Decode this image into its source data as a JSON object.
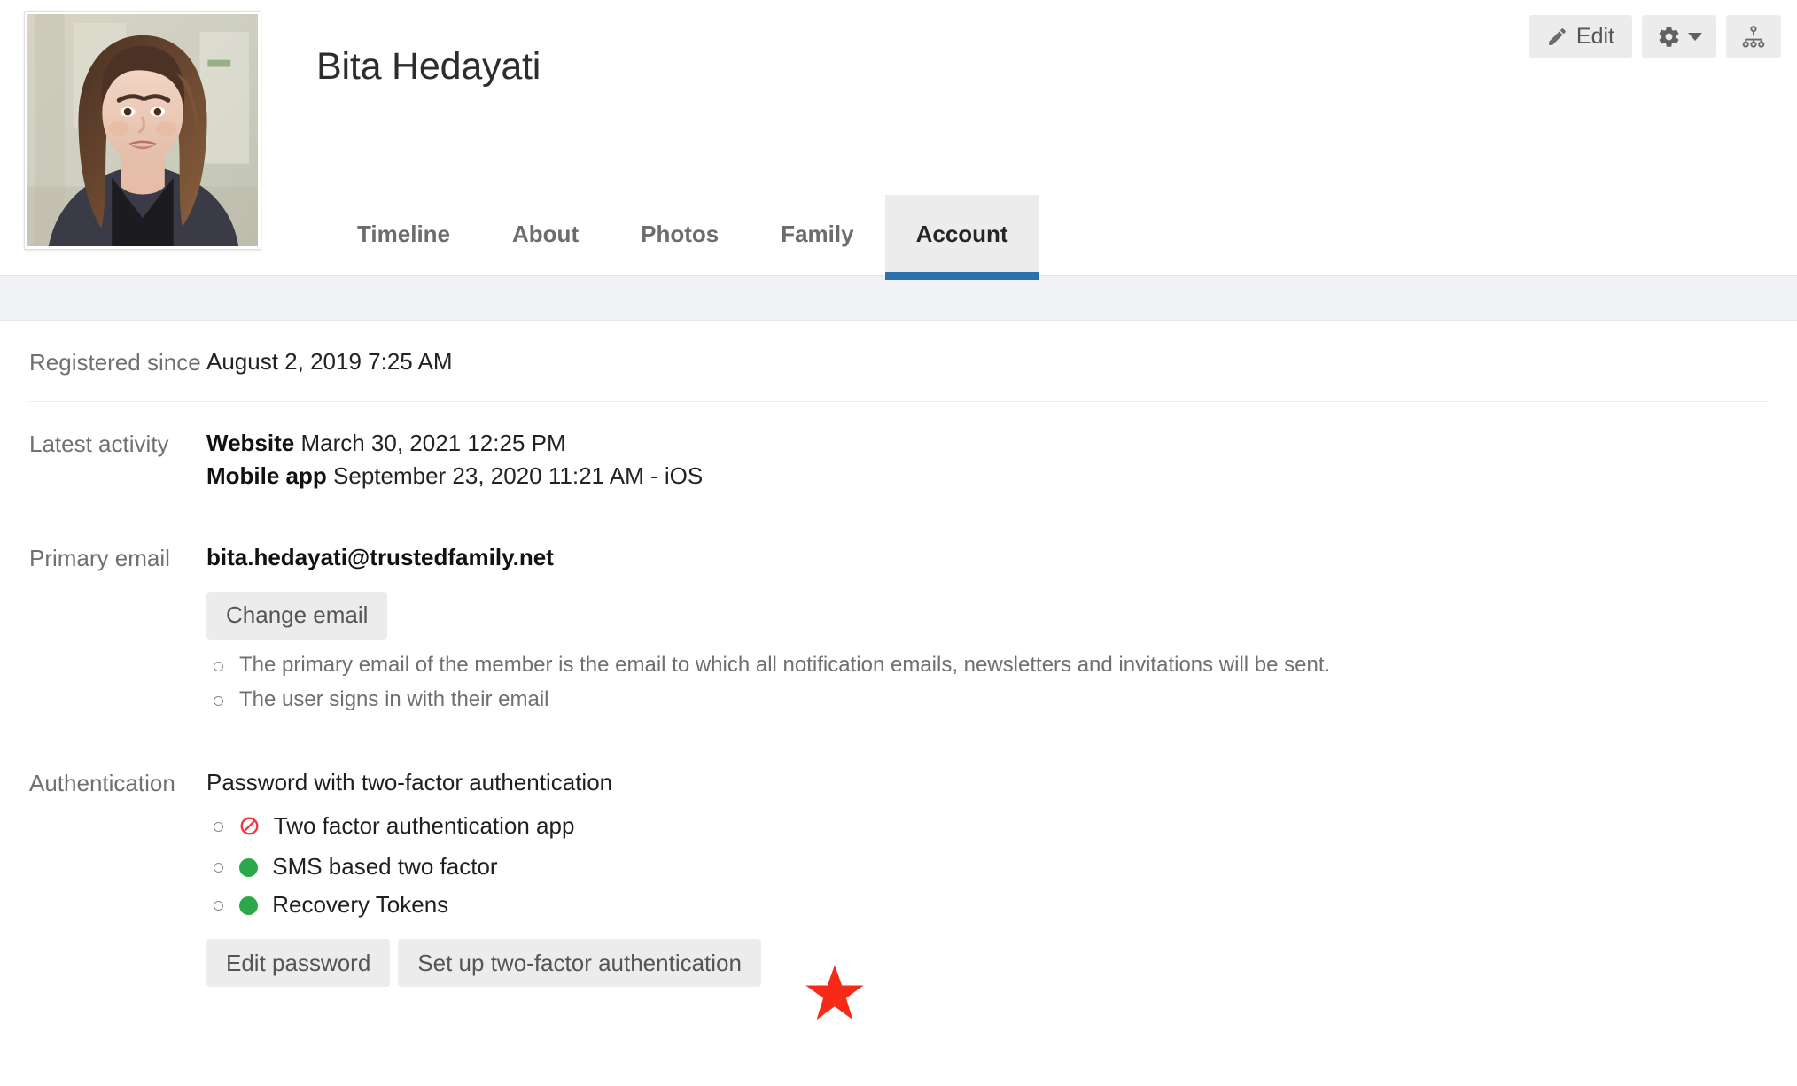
{
  "header": {
    "title": "Bita Hedayati",
    "avatar_alt": "Bita Hedayati profile photo",
    "actions": [
      {
        "name": "edit",
        "label": "Edit",
        "icon": "pencil-icon"
      },
      {
        "name": "settings",
        "label": "",
        "icon": "gear-icon"
      },
      {
        "name": "org-chart",
        "label": "",
        "icon": "sitemap-icon"
      }
    ]
  },
  "tabs": [
    {
      "label": "Timeline",
      "active": false
    },
    {
      "label": "About",
      "active": false
    },
    {
      "label": "Photos",
      "active": false
    },
    {
      "label": "Family",
      "active": false
    },
    {
      "label": "Account",
      "active": true
    }
  ],
  "colors": {
    "tab_active_underline": "#2b71ad",
    "tab_active_bg": "#ececec",
    "button_bg": "#ececec",
    "status_ok": "#2ba84a",
    "status_blocked": "#f4333d",
    "annotation_star": "#f72a18",
    "subbar_bg": "#eff1f4"
  },
  "account": {
    "registered": {
      "label": "Registered since",
      "value": "August 2, 2019 7:25 AM"
    },
    "latest_activity": {
      "label": "Latest activity",
      "entries": [
        {
          "source": "Website",
          "detail": "March 30, 2021 12:25 PM"
        },
        {
          "source": "Mobile app",
          "detail": "September 23, 2020 11:21 AM - iOS"
        }
      ]
    },
    "primary_email": {
      "label": "Primary email",
      "value": "bita.hedayati@trustedfamily.net",
      "change_button": "Change email",
      "notes": [
        "The primary email of the member is the email to which all notification emails, newsletters and invitations will be sent.",
        "The user signs in with their email"
      ]
    },
    "authentication": {
      "label": "Authentication",
      "method": "Password with two-factor authentication",
      "methods": [
        {
          "name": "Two factor authentication app",
          "status": "blocked",
          "icon": "prohibited-icon"
        },
        {
          "name": "SMS based two factor",
          "status": "enabled",
          "icon": "green-dot-icon"
        },
        {
          "name": "Recovery Tokens",
          "status": "enabled",
          "icon": "green-dot-icon"
        }
      ],
      "buttons": [
        "Edit password",
        "Set up two-factor authentication"
      ]
    }
  }
}
